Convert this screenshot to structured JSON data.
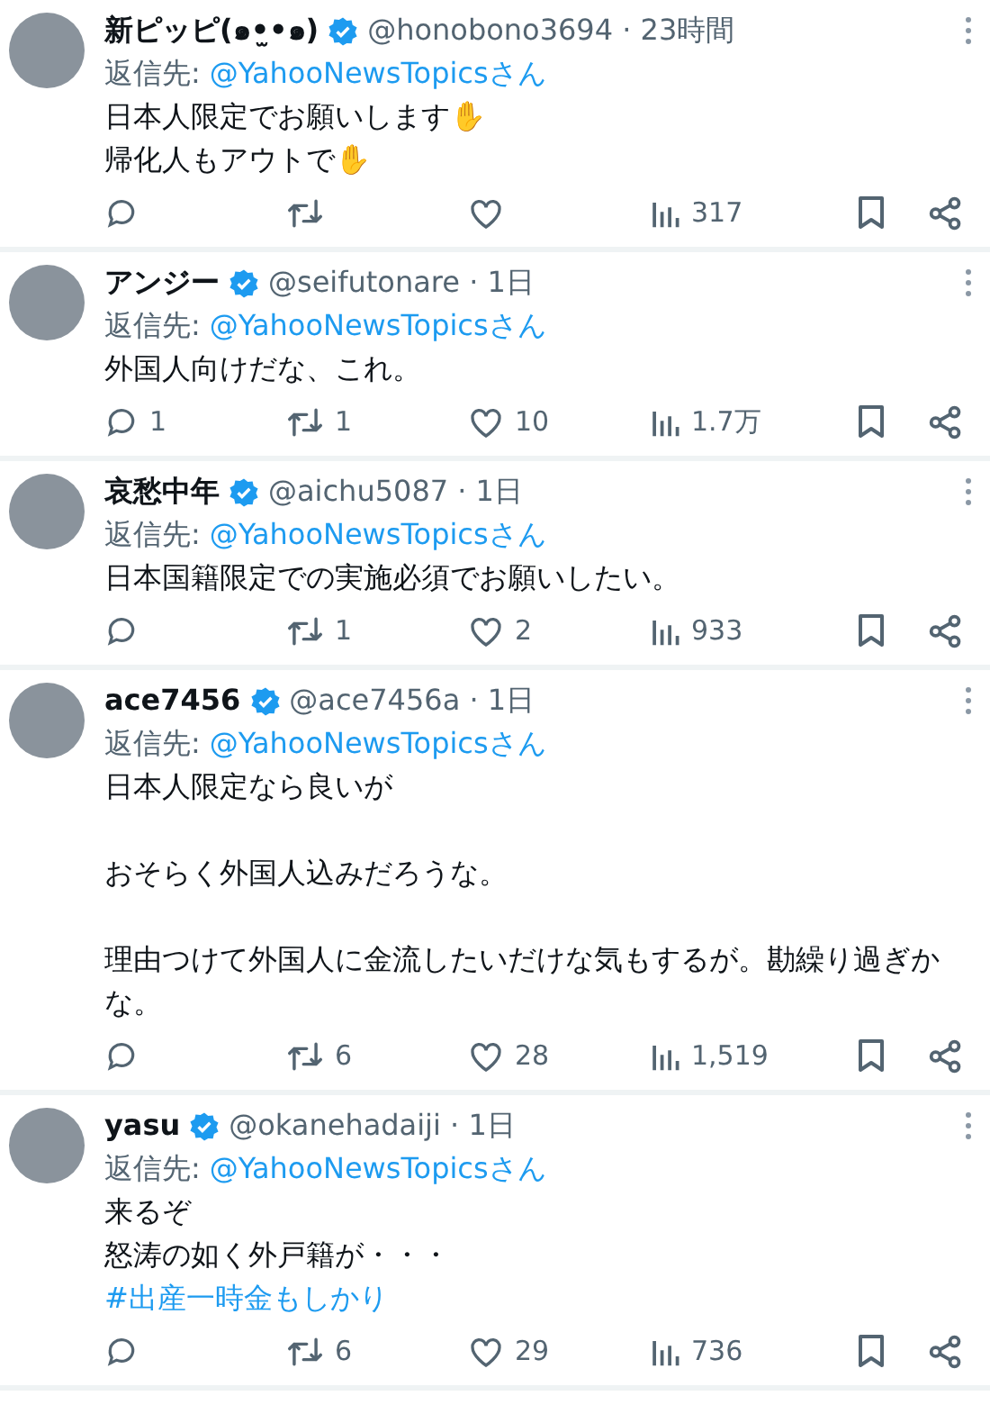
{
  "tweets": [
    {
      "name": "新ピッピ(๑•̫•๑)",
      "verified": true,
      "handle": "@honobono3694",
      "time": "· 23時間",
      "reply_to_label": "返信先:",
      "reply_to": "@YahooNewsTopicsさん",
      "paragraphs": [
        [
          "日本人限定でお願いします✋",
          "帰化人もアウトで✋"
        ]
      ],
      "actions": [
        {
          "kind": "reply"
        },
        {
          "kind": "retweet"
        },
        {
          "kind": "like"
        },
        {
          "kind": "views",
          "count": "317"
        }
      ]
    },
    {
      "name": "アンジー",
      "verified": true,
      "handle": "@seifutonare",
      "time": "· 1日",
      "reply_to_label": "返信先:",
      "reply_to": "@YahooNewsTopicsさん",
      "paragraphs": [
        [
          "外国人向けだな、これ。"
        ]
      ],
      "actions": [
        {
          "kind": "reply",
          "count": "1"
        },
        {
          "kind": "retweet",
          "count": "1"
        },
        {
          "kind": "like",
          "count": "10"
        },
        {
          "kind": "views",
          "count": "1.7万"
        }
      ]
    },
    {
      "name": "哀愁中年",
      "verified": true,
      "handle": "@aichu5087",
      "time": "· 1日",
      "reply_to_label": "返信先:",
      "reply_to": "@YahooNewsTopicsさん",
      "paragraphs": [
        [
          "日本国籍限定での実施必須でお願いしたい。"
        ]
      ],
      "actions": [
        {
          "kind": "reply"
        },
        {
          "kind": "retweet",
          "count": "1"
        },
        {
          "kind": "like",
          "count": "2"
        },
        {
          "kind": "views",
          "count": "933"
        }
      ]
    },
    {
      "name": "ace7456",
      "verified": true,
      "handle": "@ace7456a",
      "time": "· 1日",
      "reply_to_label": "返信先:",
      "reply_to": "@YahooNewsTopicsさん",
      "paragraphs": [
        [
          "日本人限定なら良いが"
        ],
        [
          "おそらく外国人込みだろうな。"
        ],
        [
          "理由つけて外国人に金流したいだけな気もするが。勘繰り過ぎかな。"
        ]
      ],
      "actions": [
        {
          "kind": "reply"
        },
        {
          "kind": "retweet",
          "count": "6"
        },
        {
          "kind": "like",
          "count": "28"
        },
        {
          "kind": "views",
          "count": "1,519"
        }
      ]
    },
    {
      "name": "yasu",
      "verified": true,
      "handle": "@okanehadaiji",
      "time": "· 1日",
      "reply_to_label": "返信先:",
      "reply_to": "@YahooNewsTopicsさん",
      "paragraphs": [
        [
          "来るぞ",
          "怒涛の如く外戸籍が・・・"
        ]
      ],
      "hashtag": "#出産一時金もしかり",
      "actions": [
        {
          "kind": "reply"
        },
        {
          "kind": "retweet",
          "count": "6"
        },
        {
          "kind": "like",
          "count": "29"
        },
        {
          "kind": "views",
          "count": "736"
        }
      ]
    }
  ]
}
